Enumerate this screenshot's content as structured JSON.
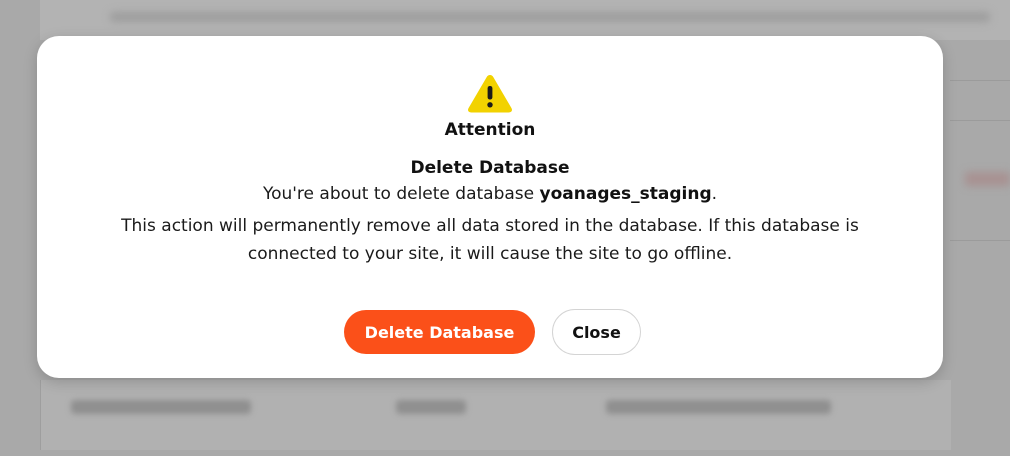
{
  "dialog": {
    "attention_label": "Attention",
    "title": "Delete Database",
    "message_prefix": "You're about to delete database ",
    "database_name": "yoanages_staging",
    "message_suffix": ".",
    "body": "This action will permanently remove all data stored in the database. If this database is connected to your site, it will cause the site to go offline.",
    "icon": "warning-triangle-icon"
  },
  "buttons": {
    "delete_label": "Delete Database",
    "close_label": "Close"
  },
  "colors": {
    "accent": "#fb5019",
    "warning": "#f2d200",
    "backdrop": "#a9a9a9"
  }
}
